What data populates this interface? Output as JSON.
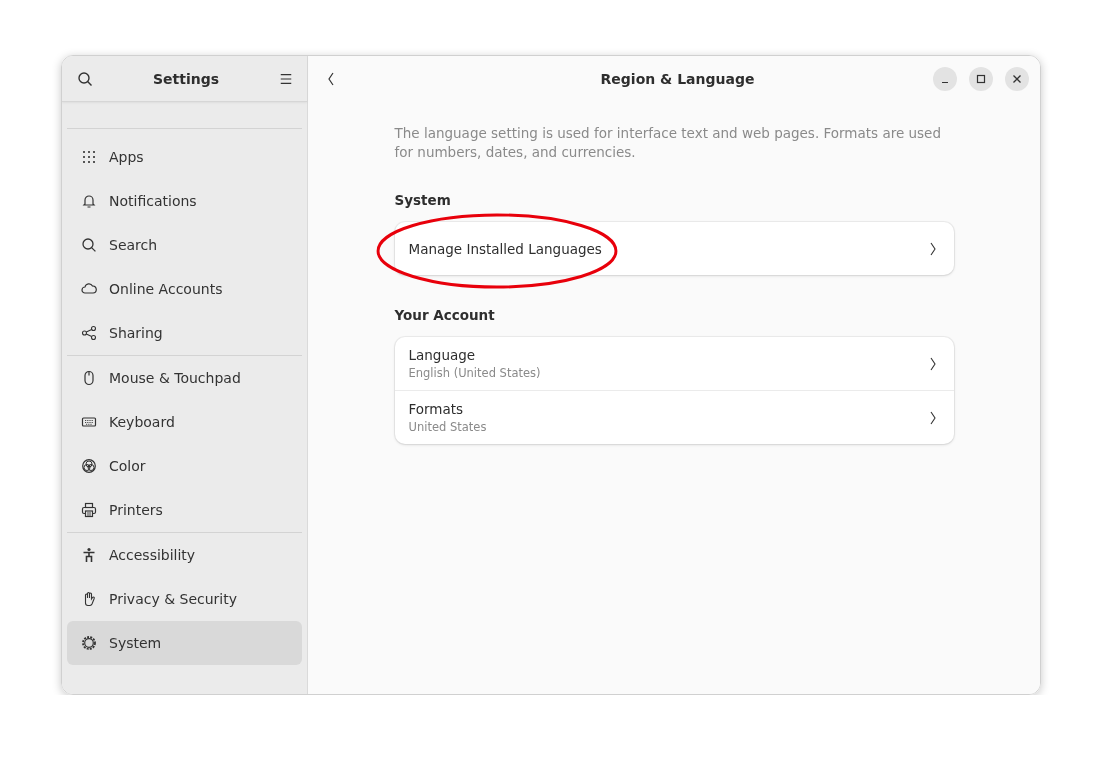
{
  "window": {
    "title": "Region & Language"
  },
  "sidebar": {
    "title": "Settings",
    "sections": [
      {
        "items": [
          {
            "label": "Apps",
            "selected": false
          },
          {
            "label": "Notifications",
            "selected": false
          },
          {
            "label": "Search",
            "selected": false
          },
          {
            "label": "Online Accounts",
            "selected": false
          },
          {
            "label": "Sharing",
            "selected": false
          }
        ]
      },
      {
        "items": [
          {
            "label": "Mouse & Touchpad",
            "selected": false
          },
          {
            "label": "Keyboard",
            "selected": false
          },
          {
            "label": "Color",
            "selected": false
          },
          {
            "label": "Printers",
            "selected": false
          }
        ]
      },
      {
        "items": [
          {
            "label": "Accessibility",
            "selected": false
          },
          {
            "label": "Privacy & Security",
            "selected": false
          },
          {
            "label": "System",
            "selected": true
          }
        ]
      }
    ]
  },
  "description": "The language setting is used for interface text and web pages. Formats are used for numbers, dates, and currencies.",
  "groups": [
    {
      "heading": "System",
      "rows": [
        {
          "title": "Manage Installed Languages",
          "highlighted": true
        }
      ]
    },
    {
      "heading": "Your Account",
      "rows": [
        {
          "title": "Language",
          "subtitle": "English (United States)",
          "highlighted": false
        },
        {
          "title": "Formats",
          "subtitle": "United States",
          "highlighted": false
        }
      ]
    }
  ]
}
